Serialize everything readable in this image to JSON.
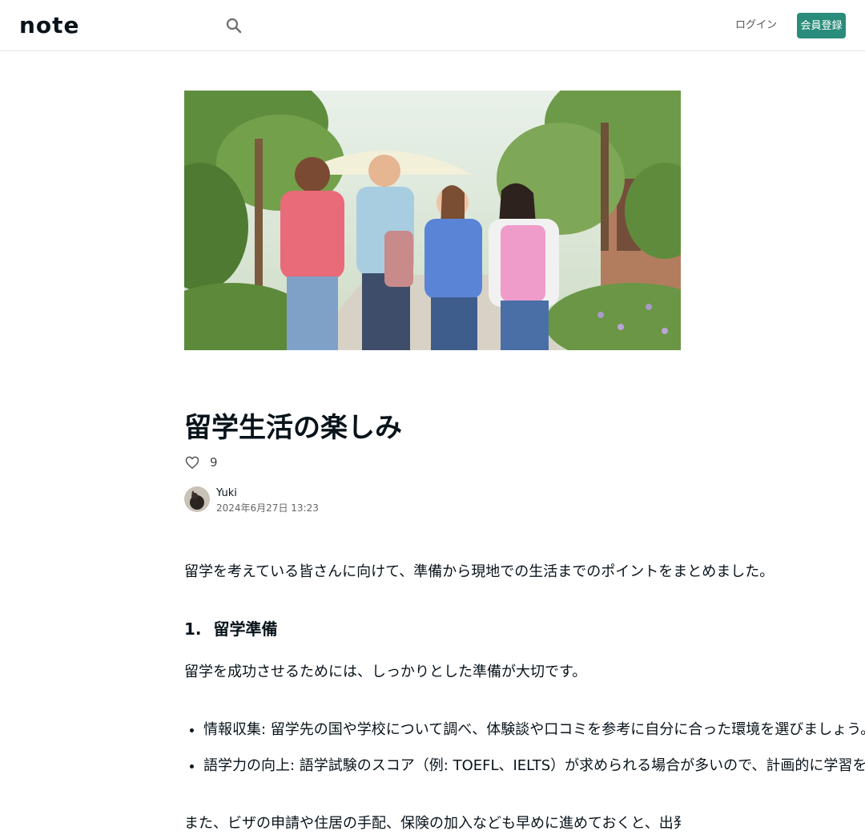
{
  "header": {
    "logo": "note",
    "login_label": "ログイン",
    "signup_label": "会員登録"
  },
  "article": {
    "title": "留学生活の楽しみ",
    "like_count": "9",
    "author": "Yuki",
    "date": "2024年6月27日 13:23",
    "intro": "留学を考えている皆さんに向けて、準備から現地での生活までのポイントをまとめました。",
    "section_number": "1.",
    "section_title": "留学準備",
    "section_lead": "留学を成功させるためには、しっかりとした準備が大切です。",
    "bullets": [
      "情報収集: 留学先の国や学校について調べ、体験談や口コミを参考に自分に合った環境を選びましょう。",
      "語学力の向上: 語学試験のスコア（例: TOEFL、IELTS）が求められる場合が多いので、計画的に学習を。"
    ],
    "trailing_text": "また、ビザの申請や住居の手配、保険の加入なども早めに進めておくと、出発前に慌てることがありません。"
  },
  "colors": {
    "brand_green": "#2a8c7b",
    "text_main": "#08131a",
    "header_border": "#e4e4e4"
  },
  "icons": {
    "search": "search-icon",
    "like": "heart-icon"
  }
}
